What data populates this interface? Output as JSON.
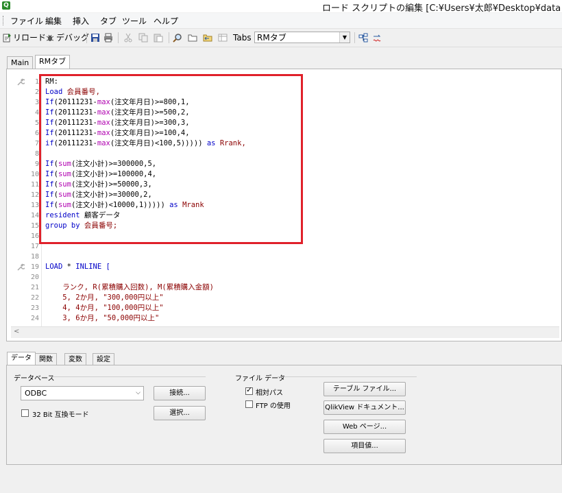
{
  "window": {
    "title": "ロード スクリプトの編集 [C:¥Users¥太郎¥Desktop¥data",
    "app_icon": "Q"
  },
  "menu": [
    "ファイル",
    "編集",
    "挿入",
    "タブ",
    "ツール",
    "ヘルプ"
  ],
  "toolbar": {
    "reload_label": "リロード",
    "debug_label": "デバッグ",
    "tabs_label": "Tabs",
    "tab_select_value": "RMタブ",
    "icons": [
      "reload-icon",
      "debug-icon",
      "save-icon",
      "print-icon",
      "cut-icon",
      "copy-icon",
      "paste-icon",
      "find-icon",
      "open-folder-icon",
      "back-folder-icon",
      "table-icon",
      "promote-tab-icon",
      "expression-icon"
    ]
  },
  "editor_tabs": [
    "Main",
    "RMタブ"
  ],
  "active_editor_tab": "RMタブ",
  "script_lines": [
    {
      "n": "1",
      "parts": [
        {
          "t": "RM:",
          "c": "p"
        }
      ]
    },
    {
      "n": "2",
      "parts": [
        {
          "t": "Load",
          "c": "k"
        },
        {
          "t": " 会員番号,",
          "c": "s"
        }
      ]
    },
    {
      "n": "3",
      "parts": [
        {
          "t": "If",
          "c": "k"
        },
        {
          "t": "(20111231-",
          "c": "p"
        },
        {
          "t": "max",
          "c": "f"
        },
        {
          "t": "(注文年月日)>=800,1,",
          "c": "p"
        }
      ]
    },
    {
      "n": "4",
      "parts": [
        {
          "t": "If",
          "c": "k"
        },
        {
          "t": "(20111231-",
          "c": "p"
        },
        {
          "t": "max",
          "c": "f"
        },
        {
          "t": "(注文年月日)>=500,2,",
          "c": "p"
        }
      ]
    },
    {
      "n": "5",
      "parts": [
        {
          "t": "If",
          "c": "k"
        },
        {
          "t": "(20111231-",
          "c": "p"
        },
        {
          "t": "max",
          "c": "f"
        },
        {
          "t": "(注文年月日)>=300,3,",
          "c": "p"
        }
      ]
    },
    {
      "n": "6",
      "parts": [
        {
          "t": "If",
          "c": "k"
        },
        {
          "t": "(20111231-",
          "c": "p"
        },
        {
          "t": "max",
          "c": "f"
        },
        {
          "t": "(注文年月日)>=100,4,",
          "c": "p"
        }
      ]
    },
    {
      "n": "7",
      "parts": [
        {
          "t": "if",
          "c": "k"
        },
        {
          "t": "(20111231-",
          "c": "p"
        },
        {
          "t": "max",
          "c": "f"
        },
        {
          "t": "(注文年月日)<100,5))))) ",
          "c": "p"
        },
        {
          "t": "as",
          "c": "k"
        },
        {
          "t": " Rrank,",
          "c": "s"
        }
      ]
    },
    {
      "n": "8",
      "parts": []
    },
    {
      "n": "9",
      "parts": [
        {
          "t": "If",
          "c": "k"
        },
        {
          "t": "(",
          "c": "p"
        },
        {
          "t": "sum",
          "c": "f"
        },
        {
          "t": "(注文小計)>=300000,5,",
          "c": "p"
        }
      ]
    },
    {
      "n": "10",
      "parts": [
        {
          "t": "If",
          "c": "k"
        },
        {
          "t": "(",
          "c": "p"
        },
        {
          "t": "sum",
          "c": "f"
        },
        {
          "t": "(注文小計)>=100000,4,",
          "c": "p"
        }
      ]
    },
    {
      "n": "11",
      "parts": [
        {
          "t": "If",
          "c": "k"
        },
        {
          "t": "(",
          "c": "p"
        },
        {
          "t": "sum",
          "c": "f"
        },
        {
          "t": "(注文小計)>=50000,3,",
          "c": "p"
        }
      ]
    },
    {
      "n": "12",
      "parts": [
        {
          "t": "If",
          "c": "k"
        },
        {
          "t": "(",
          "c": "p"
        },
        {
          "t": "sum",
          "c": "f"
        },
        {
          "t": "(注文小計)>=30000,2,",
          "c": "p"
        }
      ]
    },
    {
      "n": "13",
      "parts": [
        {
          "t": "If",
          "c": "k"
        },
        {
          "t": "(",
          "c": "p"
        },
        {
          "t": "sum",
          "c": "f"
        },
        {
          "t": "(注文小計)<10000,1))))) ",
          "c": "p"
        },
        {
          "t": "as",
          "c": "k"
        },
        {
          "t": " Mrank",
          "c": "s"
        }
      ]
    },
    {
      "n": "14",
      "parts": [
        {
          "t": "resident",
          "c": "k"
        },
        {
          "t": " 顧客データ",
          "c": "p"
        }
      ]
    },
    {
      "n": "15",
      "parts": [
        {
          "t": "group by",
          "c": "k"
        },
        {
          "t": " 会員番号;",
          "c": "s"
        }
      ]
    },
    {
      "n": "16",
      "parts": []
    },
    {
      "n": "17",
      "parts": []
    },
    {
      "n": "18",
      "parts": []
    },
    {
      "n": "19",
      "parts": [
        {
          "t": "LOAD",
          "c": "k"
        },
        {
          "t": " * ",
          "c": "p"
        },
        {
          "t": "INLINE",
          "c": "k"
        },
        {
          "t": " [",
          "c": "k"
        }
      ]
    },
    {
      "n": "20",
      "parts": []
    },
    {
      "n": "21",
      "parts": [
        {
          "t": "    ランク, R(累積購入回数), M(累積購入金額)",
          "c": "s"
        }
      ]
    },
    {
      "n": "22",
      "parts": [
        {
          "t": "    5, 2か月, \"300,000円以上\"",
          "c": "s"
        }
      ]
    },
    {
      "n": "23",
      "parts": [
        {
          "t": "    4, 4か月, \"100,000円以上\"",
          "c": "s"
        }
      ]
    },
    {
      "n": "24",
      "parts": [
        {
          "t": "    3, 6か月, \"50,000円以上\"",
          "c": "s"
        }
      ]
    }
  ],
  "bottom_tabs": [
    "データ",
    "関数",
    "変数",
    "設定"
  ],
  "active_bottom_tab": "データ",
  "database": {
    "group_label": "データベース",
    "selected": "ODBC",
    "connect_button": "接続...",
    "select_button": "選択...",
    "compat_checkbox_label": "32 Bit 互換モード",
    "compat_checked": false
  },
  "file_data": {
    "group_label": "ファイル データ",
    "relative_path_label": "相対パス",
    "relative_path_checked": true,
    "ftp_label": "FTP の使用",
    "ftp_checked": false,
    "buttons": [
      "テーブル ファイル...",
      "QlikView ドキュメント...",
      "Web ページ...",
      "項目値..."
    ]
  },
  "colors": {
    "keyword": "#0000c8",
    "function": "#b000b0",
    "string": "#8b0000",
    "highlight_box": "#e0202a"
  }
}
